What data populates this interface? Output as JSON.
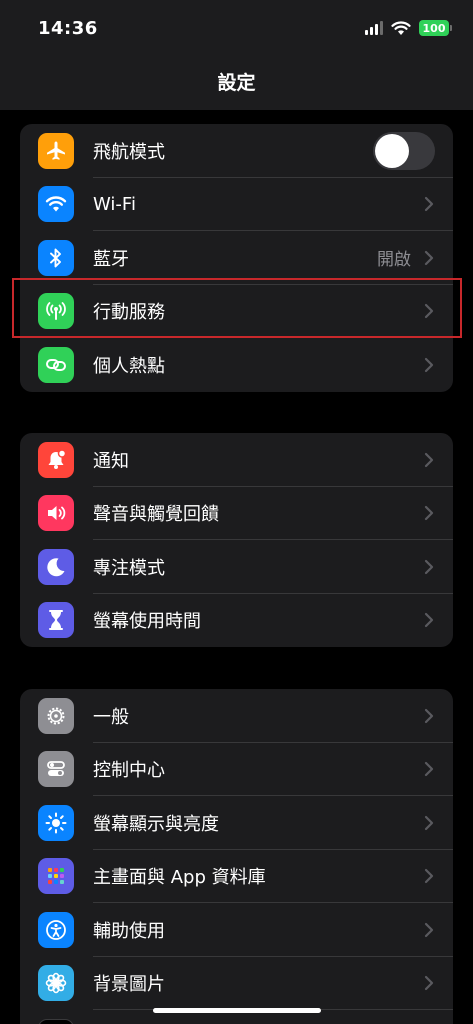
{
  "status": {
    "time": "14:36",
    "battery": "100"
  },
  "nav": {
    "title": "設定"
  },
  "groups": [
    {
      "items": [
        {
          "label": "飛航模式",
          "icon": "airplane-icon",
          "color": "#ff9f0a",
          "control": "toggle",
          "toggle_on": false
        },
        {
          "label": "Wi-Fi",
          "icon": "wifi-icon",
          "color": "#0a84ff"
        },
        {
          "label": "藍牙",
          "icon": "bluetooth-icon",
          "color": "#0a84ff",
          "value": "開啟"
        },
        {
          "label": "行動服務",
          "icon": "cellular-antenna-icon",
          "color": "#30d158"
        },
        {
          "label": "個人熱點",
          "icon": "hotspot-chain-icon",
          "color": "#30d158"
        }
      ]
    },
    {
      "items": [
        {
          "label": "通知",
          "icon": "bell-icon",
          "color": "#ff453a"
        },
        {
          "label": "聲音與觸覺回饋",
          "icon": "speaker-icon",
          "color": "#ff375f"
        },
        {
          "label": "專注模式",
          "icon": "moon-icon",
          "color": "#5e5ce6"
        },
        {
          "label": "螢幕使用時間",
          "icon": "hourglass-icon",
          "color": "#5e5ce6"
        }
      ]
    },
    {
      "items": [
        {
          "label": "一般",
          "icon": "gear-icon",
          "color": "#8e8e93"
        },
        {
          "label": "控制中心",
          "icon": "toggles-icon",
          "color": "#8e8e93"
        },
        {
          "label": "螢幕顯示與亮度",
          "icon": "sun-icon",
          "color": "#0a84ff"
        },
        {
          "label": "主畫面與 App 資料庫",
          "icon": "app-grid-icon",
          "color": "#5e5ce6"
        },
        {
          "label": "輔助使用",
          "icon": "accessibility-icon",
          "color": "#0a84ff"
        },
        {
          "label": "背景圖片",
          "icon": "flower-icon",
          "color": "#32ade6"
        }
      ]
    }
  ]
}
